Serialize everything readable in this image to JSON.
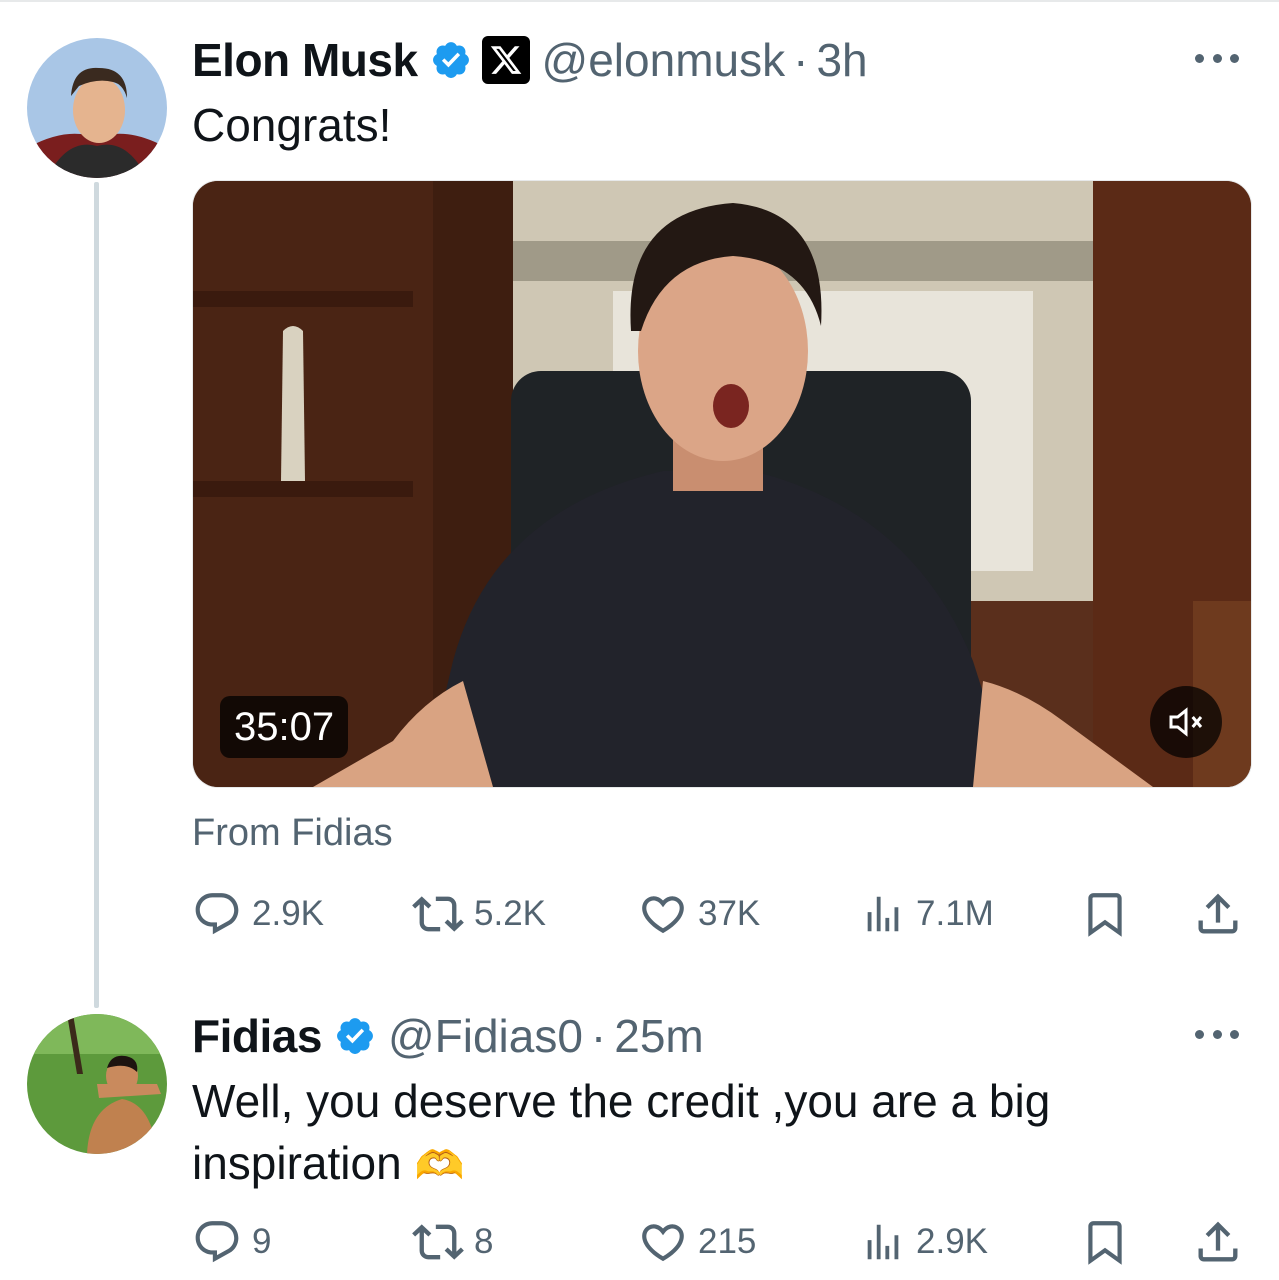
{
  "tweets": [
    {
      "author_name": "Elon Musk",
      "handle": "@elonmusk",
      "separator": "·",
      "time": "3h",
      "text": "Congrats!",
      "media": {
        "duration": "35:07",
        "source_label": "From Fidias"
      },
      "stats": {
        "replies": "2.9K",
        "reposts": "5.2K",
        "likes": "37K",
        "views": "7.1M"
      }
    },
    {
      "author_name": "Fidias",
      "handle": "@Fidias0",
      "separator": "·",
      "time": "25m",
      "text_line1": "Well, you deserve the credit ,you are a big",
      "text_line2": "inspiration",
      "emoji": "🫶",
      "stats": {
        "replies": "9",
        "reposts": "8",
        "likes": "215",
        "views": "2.9K"
      }
    }
  ],
  "colors": {
    "verified": "#1d9bf0",
    "secondary_text": "#536471",
    "thread_line": "#cfd9de"
  },
  "icons": [
    "verified-badge-icon",
    "x-affiliation-icon",
    "more-icon",
    "mute-icon",
    "reply-icon",
    "repost-icon",
    "like-icon",
    "views-icon",
    "bookmark-icon",
    "share-icon"
  ]
}
